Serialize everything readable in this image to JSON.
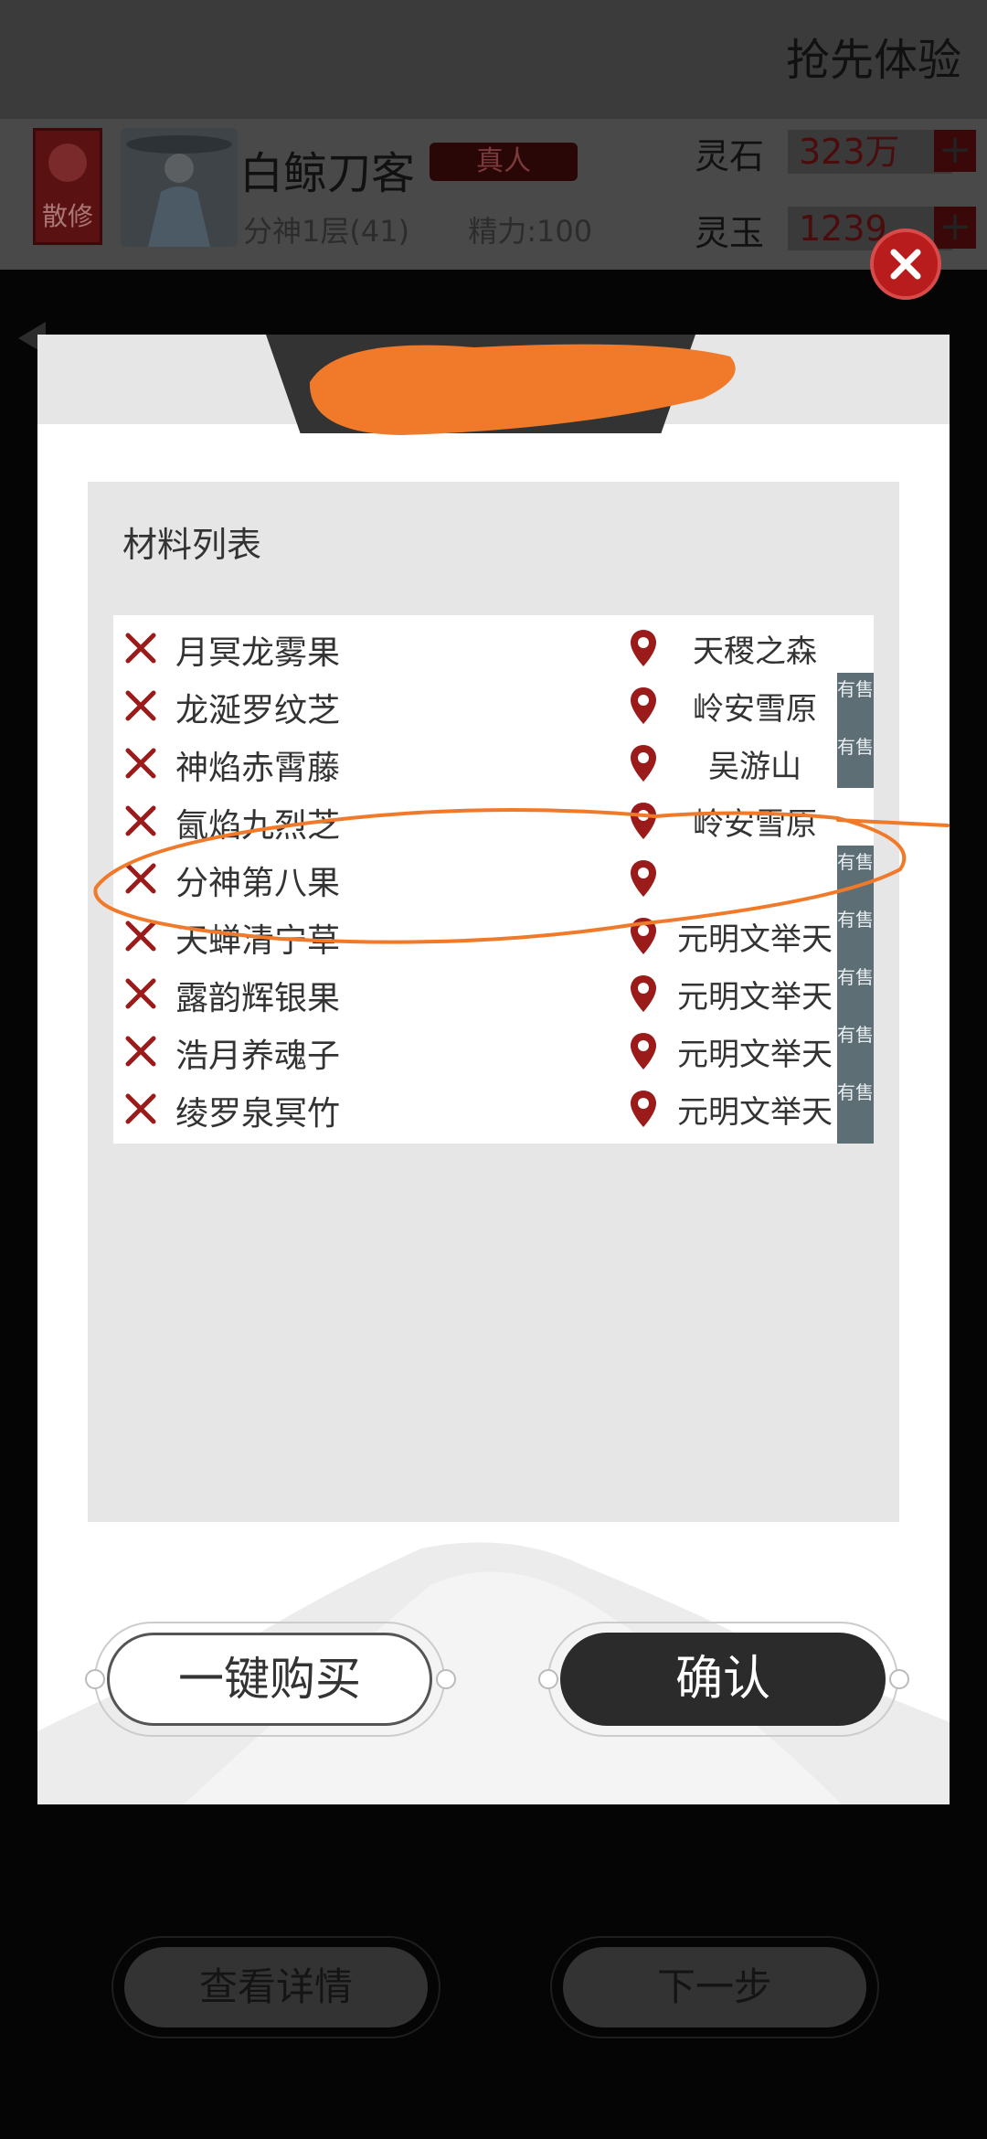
{
  "header": {
    "title": "抢先体验"
  },
  "player": {
    "sect": "散修",
    "name": "白鲸刀客",
    "badge": "真人",
    "realm": "分神1层(41)",
    "energy": "精力:100"
  },
  "currencies": [
    {
      "label": "灵石",
      "value": "323万"
    },
    {
      "label": "灵玉",
      "value": "1239"
    }
  ],
  "modal": {
    "panel_title": "材料列表",
    "materials": [
      {
        "name": "月冥龙雾果",
        "location": "天稷之森",
        "sale": ""
      },
      {
        "name": "龙涎罗纹芝",
        "location": "岭安雪原",
        "sale": "有售"
      },
      {
        "name": "神焰赤霄藤",
        "location": "吴游山",
        "sale": "有售"
      },
      {
        "name": "氤焰九烈芝",
        "location": "岭安雪原",
        "sale": ""
      },
      {
        "name": "分神第八果",
        "location": "",
        "sale": "有售"
      },
      {
        "name": "天蝉清宁草",
        "location": "元明文举天",
        "sale": "有售"
      },
      {
        "name": "露韵辉银果",
        "location": "元明文举天",
        "sale": "有售"
      },
      {
        "name": "浩月养魂子",
        "location": "元明文举天",
        "sale": "有售"
      },
      {
        "name": "绫罗泉冥竹",
        "location": "元明文举天",
        "sale": "有售"
      }
    ],
    "buy_all_label": "一键购买",
    "confirm_label": "确认"
  },
  "footer": {
    "details_label": "查看详情",
    "next_label": "下一步"
  },
  "colors": {
    "accent_red": "#9b1b1b",
    "sale_tag": "#5e6e75",
    "annotation_orange": "#f07a2a"
  }
}
